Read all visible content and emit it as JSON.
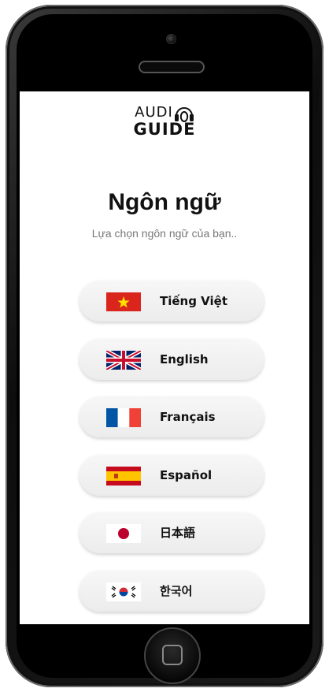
{
  "logo": {
    "line1": "AUDI",
    "line2": "GUIDE"
  },
  "title": "Ngôn ngữ",
  "subtitle": "Lựa chọn ngôn ngữ của bạn..",
  "languages": [
    {
      "label": "Tiếng Việt",
      "flag": "vietnam-flag-icon"
    },
    {
      "label": "English",
      "flag": "uk-flag-icon"
    },
    {
      "label": "Français",
      "flag": "france-flag-icon"
    },
    {
      "label": "Español",
      "flag": "spain-flag-icon"
    },
    {
      "label": "日本語",
      "flag": "japan-flag-icon"
    },
    {
      "label": "한국어",
      "flag": "korea-flag-icon"
    }
  ],
  "colors": {
    "button_bg": "#efefef",
    "text": "#111111",
    "subtitle": "#777777"
  }
}
